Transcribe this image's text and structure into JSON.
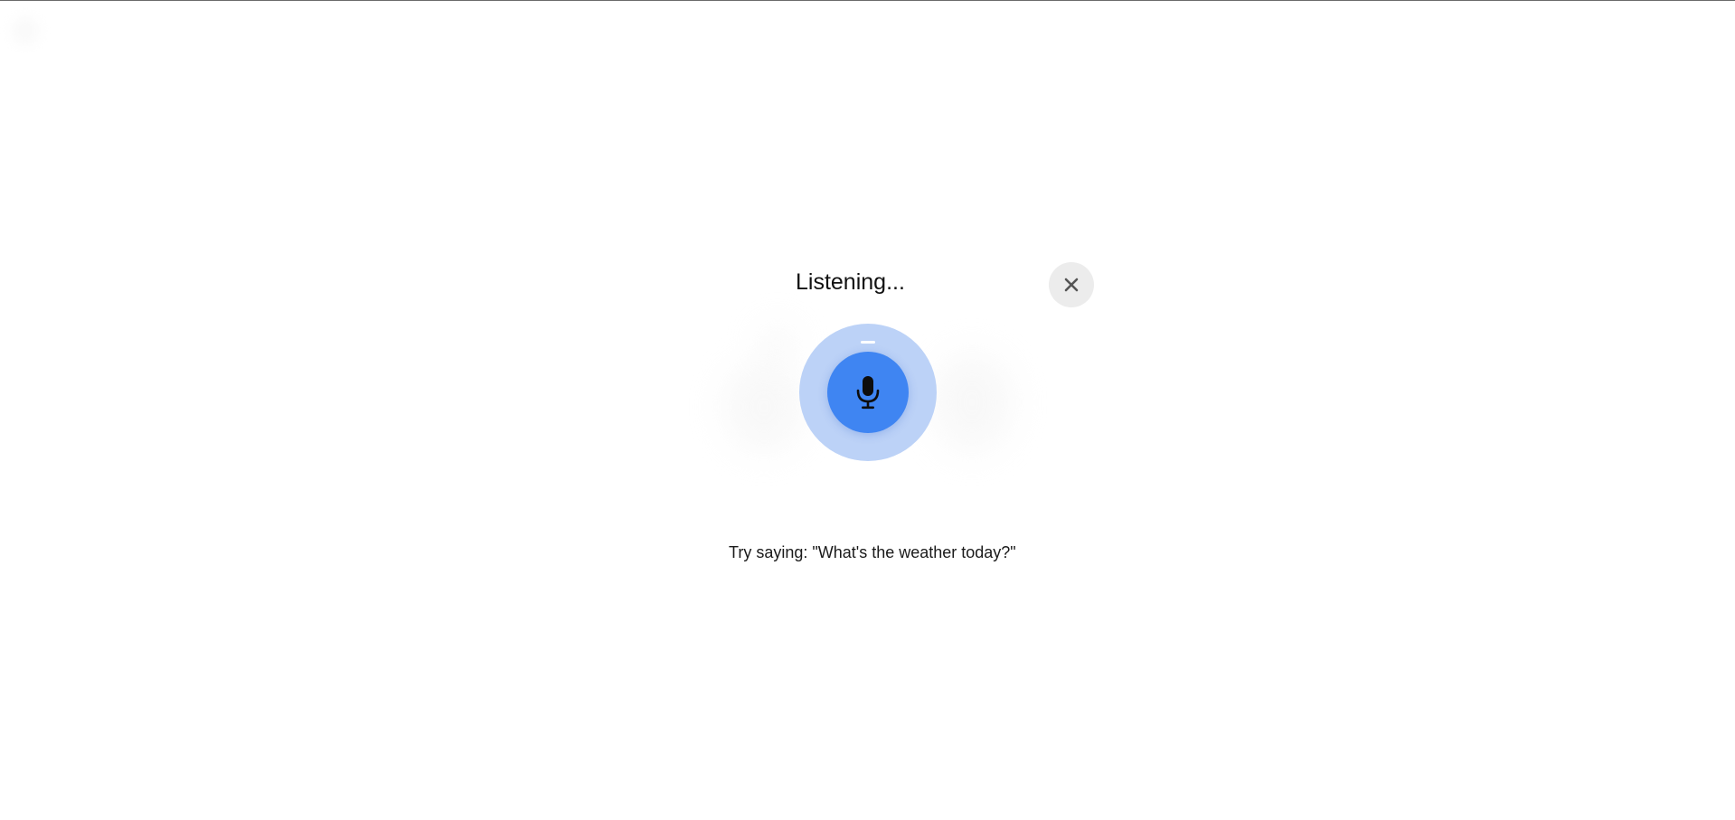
{
  "voice_overlay": {
    "status_text": "Listening...",
    "hint_text": "Try saying: \"What's the weather today?\"",
    "close_icon": "close-icon",
    "mic_icon": "microphone-icon",
    "colors": {
      "mic_button": "#3f85f2",
      "mic_halo": "#bcd2f7",
      "close_button_bg": "#ececec",
      "close_icon": "#555555",
      "text": "#111111"
    }
  }
}
